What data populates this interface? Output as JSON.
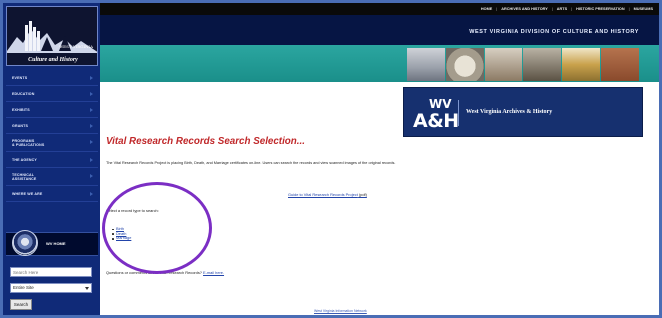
{
  "colors": {
    "frame": "#4a6db5",
    "sidebar": "#102a78",
    "title_red": "#c0282a",
    "link_blue": "#2244aa",
    "badge_navy": "#16306f",
    "band_teal": "#1a8f8a",
    "highlight": "#7b2ec4"
  },
  "logo": {
    "wv": "WEST\nVIRGINIA",
    "text": "Culture and History"
  },
  "sidebar": {
    "items": [
      {
        "label": "EVENTS"
      },
      {
        "label": "EDUCATION"
      },
      {
        "label": "EXHIBITS"
      },
      {
        "label": "GRANTS"
      },
      {
        "label": "PROGRAMS\n& PUBLICATIONS"
      },
      {
        "label": "THE AGENCY"
      },
      {
        "label": "TECHNICAL\nASSISTANCE"
      },
      {
        "label": "WHERE WE ARE"
      }
    ],
    "wv_home": "WV HOME",
    "search_placeholder": "Search Here",
    "site_select": "Entire Site",
    "search_button": "Search"
  },
  "topnav": {
    "items": [
      "HOME",
      "ARCHIVES AND HISTORY",
      "ARTS",
      "HISTORIC PRESERVATION",
      "MUSEUMS"
    ]
  },
  "header": {
    "division": "WEST VIRGINIA DIVISION OF CULTURE AND HISTORY",
    "photo_icons": [
      "building-photo-icon",
      "stone-photo-icon",
      "bird-photo-icon",
      "statue-photo-icon",
      "capitol-photo-icon",
      "brick-building-photo-icon"
    ]
  },
  "badge": {
    "wv": "WV",
    "ah": "A&H",
    "name": "West Virginia Archives & History"
  },
  "main": {
    "title": "Vital Research Records Search Selection...",
    "intro": "The Vital Research Records Project is placing Birth, Death, and Marriage certificates on-line. Users can search the records and view scanned images of the original records.",
    "guide_link": "Guide to Vital Research Records Project",
    "guide_pdf": "(pdf)",
    "select_label": "Select a record type to search:",
    "record_types": [
      "Birth",
      "Death",
      "Marriage"
    ],
    "questions_text": "Questions or comments about Vital Research Records?",
    "email_link": "E-mail here.",
    "footer_link": "West Virginia Information Network"
  }
}
